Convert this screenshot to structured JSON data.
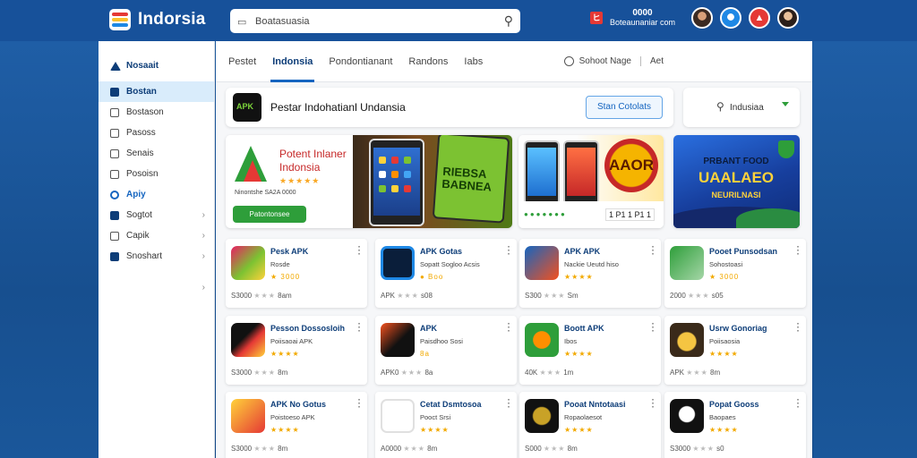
{
  "header": {
    "logo_text": "Indorsia",
    "search_placeholder": "Boatasuasia",
    "account_line1": "0000",
    "account_line2": "Boteaunaniar com",
    "flag_icon": "ヒ"
  },
  "sidebar": {
    "items": [
      {
        "label": "Nosaait"
      },
      {
        "label": "Bostan"
      },
      {
        "label": "Bostason"
      },
      {
        "label": "Pasoss"
      },
      {
        "label": "Senais"
      },
      {
        "label": "Posoisn"
      },
      {
        "label": "Apiy"
      },
      {
        "label": "Sogtot"
      },
      {
        "label": "Capik"
      },
      {
        "label": "Snoshart"
      }
    ]
  },
  "tabs": {
    "items": [
      {
        "label": "Pestet"
      },
      {
        "label": "Indonsia"
      },
      {
        "label": "Pondontianant"
      },
      {
        "label": "Randons"
      },
      {
        "label": "Iabs"
      }
    ],
    "right_label": "Sohoot Nage",
    "right_tail": "Aet"
  },
  "titlebar": {
    "title": "Pestar Indohatianl Undansia",
    "button": "Stan Cotolats"
  },
  "filter": {
    "label": "Indusiaa"
  },
  "banners": {
    "b1_title": "Potent Inlaner Indonsia",
    "b1_stars": "★★★★★",
    "b1_meta": "Ninontshe SA2A 0000",
    "b1_button": "Patontonsee",
    "b1_phone_text": "RIEBSA BABNEA",
    "b2_badge": "AAOR",
    "b2_rating": "●●●●●●●",
    "b2_code": "1 P1 1 P1 1",
    "b3_title": "PRBANT FOOD",
    "b3_big": "UAALAEO",
    "b3_sub": "NEURILNASI"
  },
  "apps": [
    {
      "name": "Pesk APK",
      "sub": "Rosde",
      "stars": "★ 3000",
      "foot": "S3000",
      "foot_stars": "★★★",
      "foot_tail": "8am"
    },
    {
      "name": "APK Gotas",
      "sub": "Sopatt Sogloo Acsis",
      "stars": "● Boo",
      "foot": "APK",
      "foot_stars": "★★★",
      "foot_tail": "s08"
    },
    {
      "name": "APK APK",
      "sub": "Nackie Ueutd hiso",
      "stars": "★★★★",
      "foot": "S300",
      "foot_stars": "★★★",
      "foot_tail": "Sm"
    },
    {
      "name": "Pooet Punsodsan",
      "sub": "Sohostoasi",
      "stars": "★ 3000",
      "foot": "2000",
      "foot_stars": "★★★",
      "foot_tail": "s05"
    },
    {
      "name": "Pesson Dossosloih",
      "sub": "Poiisaoai APK",
      "stars": "★★★★",
      "foot": "S3000",
      "foot_stars": "★★★",
      "foot_tail": "8m"
    },
    {
      "name": "APK",
      "sub": "Paisdhoo Sosi",
      "stars": "8a",
      "foot": "APK0",
      "foot_stars": "★★★",
      "foot_tail": "8a"
    },
    {
      "name": "Boott APK",
      "sub": "Ibos",
      "stars": "★★★★",
      "foot": "40K",
      "foot_stars": "★★★",
      "foot_tail": "1m"
    },
    {
      "name": "Usrw Gonoriag",
      "sub": "Poiisaosia",
      "stars": "★★★★",
      "foot": "APK",
      "foot_stars": "★★★",
      "foot_tail": "8m"
    },
    {
      "name": "APK No Gotus",
      "sub": "Poistoeso APK",
      "stars": "★★★★",
      "foot": "S3000",
      "foot_stars": "★★★",
      "foot_tail": "8m"
    },
    {
      "name": "Cetat Dsmtosoa",
      "sub": "Pooct Srsi",
      "stars": "★★★★",
      "foot": "A0000",
      "foot_stars": "★★★",
      "foot_tail": "8m"
    },
    {
      "name": "Pooat Nntotaasi",
      "sub": "Ropaolaesot",
      "stars": "★★★★",
      "foot": "S000",
      "foot_stars": "★★★",
      "foot_tail": "8m"
    },
    {
      "name": "Popat Gooss",
      "sub": "Baopaes",
      "stars": "★★★★",
      "foot": "S3000",
      "foot_stars": "★★★",
      "foot_tail": "s0"
    }
  ],
  "colors": {
    "brand_blue": "#17519a",
    "accent_blue": "#1565c0",
    "green": "#2e9e3a",
    "star": "#f2a900"
  }
}
